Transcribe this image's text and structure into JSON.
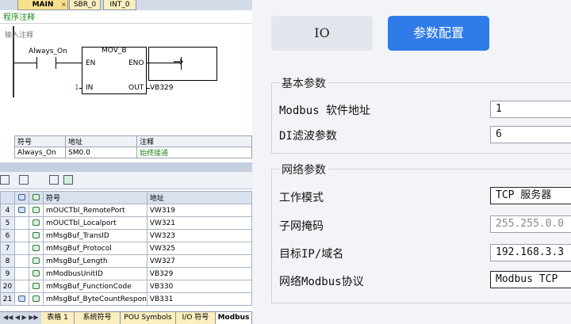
{
  "editor": {
    "tabs": [
      {
        "label": "MAIN"
      },
      {
        "label": "SBR_0"
      },
      {
        "label": "INT_0"
      }
    ],
    "tab_close": "×",
    "program_comment": "程序注释",
    "input_comment": "输入注释",
    "lad": {
      "contact_label": "Always_On",
      "block_title": "MOV_B",
      "en": "EN",
      "eno": "ENO",
      "in": "IN",
      "out": "OUT",
      "in_value": "1",
      "out_value": "VB329"
    },
    "symbol_table": {
      "headers": [
        "符号",
        "地址",
        "注释"
      ],
      "rows": [
        [
          "Always_On",
          "SM0.0",
          "始终接通"
        ]
      ]
    }
  },
  "symbols": {
    "headers": [
      "符号",
      "地址"
    ],
    "rows": [
      {
        "num": "4",
        "symbol": "mOUCTbl_RemotePort",
        "address": "VW319"
      },
      {
        "num": "5",
        "symbol": "mOUCTbl_Localport",
        "address": "VW321"
      },
      {
        "num": "6",
        "symbol": "mMsgBuf_TransID",
        "address": "VW323"
      },
      {
        "num": "7",
        "symbol": "mMsgBuf_Protocol",
        "address": "VW325"
      },
      {
        "num": "8",
        "symbol": "mMsgBuf_Length",
        "address": "VW327"
      },
      {
        "num": "9",
        "symbol": "mModbusUnitID",
        "address": "VB329"
      },
      {
        "num": "20",
        "symbol": "mMsgBuf_FunctionCode",
        "address": "VB330"
      },
      {
        "num": "21",
        "symbol": "mMsgBuf_ByteCountRespon",
        "address": "VB331"
      }
    ],
    "bottom_tabs": [
      "表格 1",
      "系统符号",
      "POU Symbols",
      "I/O 符号",
      "Modbus"
    ]
  },
  "config": {
    "io_button": "IO",
    "param_button": "参数配置",
    "basic_group": "基本参数",
    "modbus_addr_label": "Modbus 软件地址",
    "modbus_addr_value": "1",
    "di_filter_label": "DI滤波参数",
    "di_filter_value": "6",
    "network_group": "网络参数",
    "work_mode_label": "工作模式",
    "work_mode_value": "TCP 服务器",
    "subnet_label": "子网掩码",
    "subnet_value": "255.255.0.0",
    "target_ip_label": "目标IP/域名",
    "target_ip_value": "192.168.3.3",
    "protocol_label": "网络Modbus协议",
    "protocol_value": "Modbus TCP"
  },
  "colors": {
    "accent_blue": "#2f7be8",
    "comment_green": "#1d8a1d",
    "tab_yellow": "#f8e08a"
  }
}
